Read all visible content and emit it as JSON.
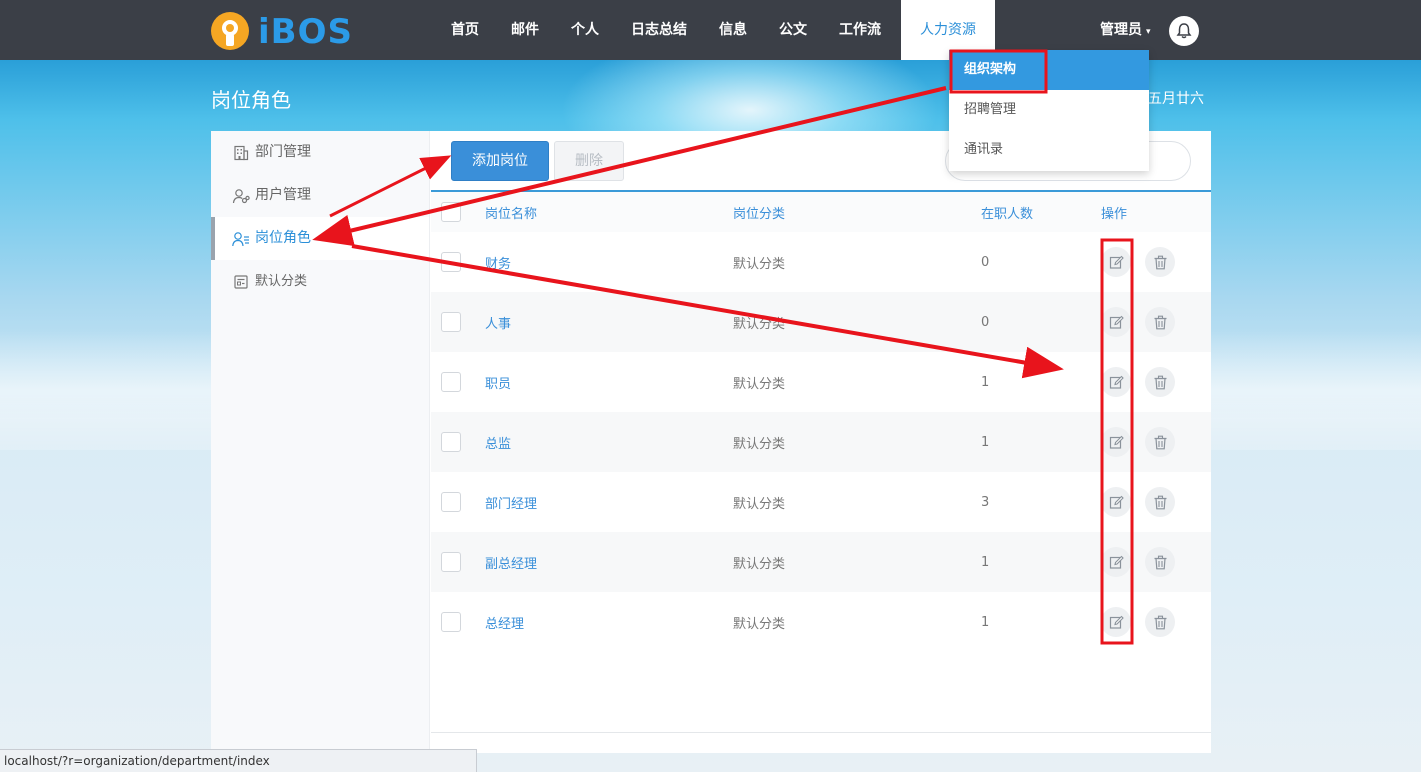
{
  "brand": {
    "logo_text": "iBOS"
  },
  "nav": {
    "items": [
      "首页",
      "邮件",
      "个人",
      "日志总结",
      "信息",
      "公文",
      "工作流"
    ],
    "active": "人力资源",
    "admin_label": "管理员",
    "admin_caret": "▾"
  },
  "page": {
    "title": "岗位角色",
    "date": "五月廿六"
  },
  "dropdown": {
    "items": [
      "组织架构",
      "招聘管理",
      "通讯录"
    ],
    "active_index": 0
  },
  "sidebar": {
    "items": [
      {
        "label": "部门管理",
        "icon": "building-icon"
      },
      {
        "label": "用户管理",
        "icon": "user-link-icon"
      },
      {
        "label": "岗位角色",
        "icon": "user-list-icon"
      },
      {
        "label": "默认分类",
        "icon": "list-doc-icon"
      }
    ],
    "active_index": 2
  },
  "toolbar": {
    "add_label": "添加岗位",
    "delete_label": "删除"
  },
  "table": {
    "headers": [
      "岗位名称",
      "岗位分类",
      "在职人数",
      "操作"
    ],
    "rows": [
      {
        "name": "财务",
        "category": "默认分类",
        "count": "0"
      },
      {
        "name": "人事",
        "category": "默认分类",
        "count": "0"
      },
      {
        "name": "职员",
        "category": "默认分类",
        "count": "1"
      },
      {
        "name": "总监",
        "category": "默认分类",
        "count": "1"
      },
      {
        "name": "部门经理",
        "category": "默认分类",
        "count": "3"
      },
      {
        "name": "副总经理",
        "category": "默认分类",
        "count": "1"
      },
      {
        "name": "总经理",
        "category": "默认分类",
        "count": "1"
      }
    ]
  },
  "status_bar": {
    "url": "localhost/?r=organization/department/index"
  },
  "colors": {
    "accent": "#3a8fd9",
    "topbar": "#3b3f47",
    "annotation": "#e8141c"
  }
}
